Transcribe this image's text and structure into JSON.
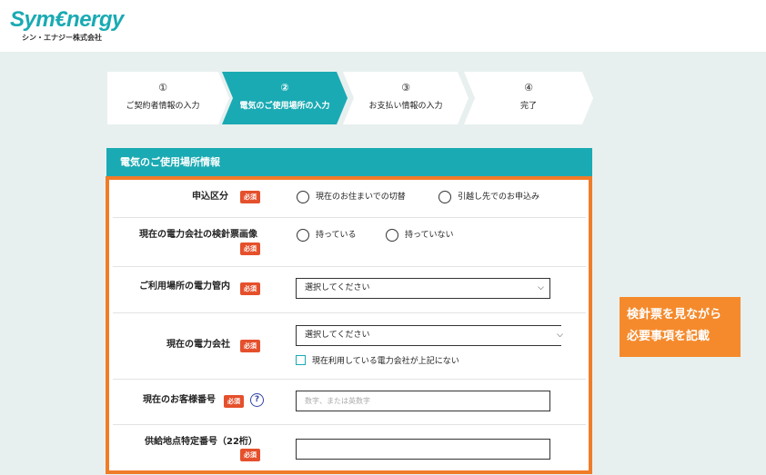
{
  "header": {
    "logo_text": "Sym€nergy",
    "company_name": "シン・エナジー株式会社"
  },
  "steps": [
    {
      "num": "①",
      "label": "ご契約者情報の入力",
      "active": false
    },
    {
      "num": "②",
      "label": "電気のご使用場所の入力",
      "active": true
    },
    {
      "num": "③",
      "label": "お支払い情報の入力",
      "active": false
    },
    {
      "num": "④",
      "label": "完了",
      "active": false
    }
  ],
  "panel": {
    "title": "電気のご使用場所情報"
  },
  "required_badge": "必須",
  "form": {
    "application_type": {
      "label": "申込区分",
      "options": [
        "現在のお住まいでの切替",
        "引越し先でのお申込み"
      ]
    },
    "meter_image": {
      "label": "現在の電力会社の検針票画像",
      "options": [
        "持っている",
        "持っていない"
      ]
    },
    "area": {
      "label": "ご利用場所の電力管内",
      "placeholder": "選択してください"
    },
    "company": {
      "label": "現在の電力会社",
      "placeholder": "選択してください",
      "checkbox_label": "現在利用している電力会社が上記にない"
    },
    "customer_number": {
      "label": "現在のお客様番号",
      "help": "?",
      "placeholder": "数字、または英数字"
    },
    "supply_point": {
      "label": "供給地点特定番号（22桁）",
      "value": ""
    }
  },
  "note": {
    "line1": "検針票を見ながら",
    "line2": "必要事項を記載"
  },
  "colors": {
    "brand": "#1aaab3",
    "highlight": "#f07c28",
    "required": "#e5502c"
  }
}
